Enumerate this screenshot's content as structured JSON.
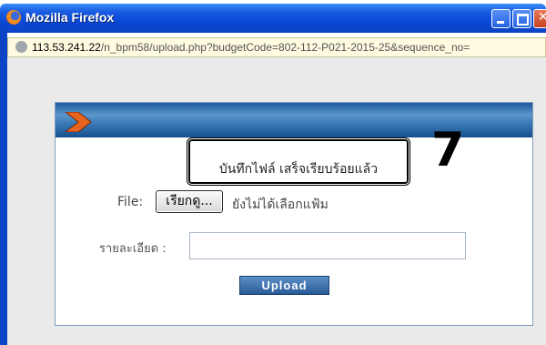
{
  "window": {
    "title": "Mozilla Firefox",
    "url_host": "113.53.241.22",
    "url_path": "/n_bpm58/upload.php?budgetCode=802-112-P021-2015-25&sequence_no="
  },
  "dialog": {
    "message": "บันทึกไฟล์ เสร็จเรียบร้อยแล้ว",
    "annotation_number": "7",
    "file_label": "File:",
    "browse_label": "เรียกดู...",
    "no_file_text": "ยังไม่ได้เลือกแฟ้ม",
    "description_label": "รายละเอียด :",
    "description_value": "",
    "upload_label": "Upload"
  },
  "colors": {
    "titlebar": "#0b44c4",
    "header_band": "#3f7dbb",
    "chevron": "#e8641e"
  }
}
